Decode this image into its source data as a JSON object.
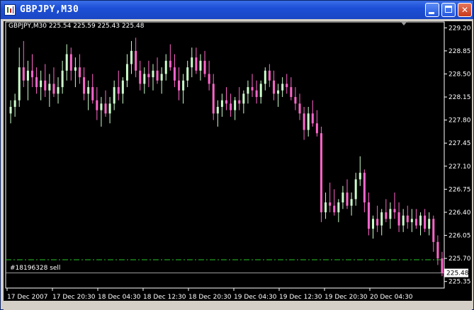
{
  "window": {
    "title": "GBPJPY,M30"
  },
  "chart": {
    "header": "GBPJPY,M30  225.54 225.59 225.43 225.48",
    "order_label": "#18196328 sell",
    "current_price": "225.48",
    "colors": {
      "bull": "#ccffcc",
      "bear": "#ff66cc",
      "order_line": "#26c326",
      "price_line": "#a0a0a0",
      "axis": "#ffffff"
    }
  },
  "chart_data": {
    "type": "candlestick",
    "symbol": "GBPJPY",
    "timeframe": "M30",
    "ylim": [
      225.25,
      229.3
    ],
    "y_ticks": [
      "229.20",
      "228.85",
      "228.50",
      "228.15",
      "227.80",
      "227.45",
      "227.10",
      "226.75",
      "226.40",
      "226.05",
      "225.70",
      "225.35"
    ],
    "x_ticks": [
      "17 Dec 2007",
      "17 Dec 20:30",
      "18 Dec 04:30",
      "18 Dec 12:30",
      "18 Dec 20:30",
      "19 Dec 04:30",
      "19 Dec 12:30",
      "19 Dec 20:30",
      "20 Dec 04:30"
    ],
    "order_level": 225.68,
    "bid": 225.48,
    "ohlc": [
      [
        227.9,
        228.1,
        227.75,
        228.0
      ],
      [
        228.0,
        228.2,
        227.85,
        228.1
      ],
      [
        228.1,
        228.9,
        228.0,
        228.6
      ],
      [
        228.6,
        229.0,
        228.3,
        228.4
      ],
      [
        228.4,
        228.7,
        228.1,
        228.55
      ],
      [
        228.55,
        228.8,
        228.3,
        228.45
      ],
      [
        228.45,
        228.6,
        228.2,
        228.3
      ],
      [
        228.3,
        228.55,
        228.1,
        228.4
      ],
      [
        228.4,
        228.65,
        228.15,
        228.25
      ],
      [
        228.25,
        228.5,
        228.0,
        228.35
      ],
      [
        228.35,
        228.6,
        228.15,
        228.2
      ],
      [
        228.2,
        228.45,
        228.05,
        228.3
      ],
      [
        228.3,
        228.7,
        228.2,
        228.55
      ],
      [
        228.55,
        228.95,
        228.4,
        228.8
      ],
      [
        228.8,
        228.9,
        228.4,
        228.55
      ],
      [
        228.55,
        228.75,
        228.3,
        228.6
      ],
      [
        228.6,
        228.8,
        228.35,
        228.45
      ],
      [
        228.45,
        228.6,
        228.1,
        228.2
      ],
      [
        228.2,
        228.4,
        227.95,
        228.3
      ],
      [
        228.3,
        228.5,
        228.05,
        228.1
      ],
      [
        228.1,
        228.3,
        227.8,
        227.95
      ],
      [
        227.95,
        228.15,
        227.7,
        228.05
      ],
      [
        228.05,
        228.25,
        227.85,
        227.9
      ],
      [
        227.9,
        228.15,
        227.75,
        228.05
      ],
      [
        228.05,
        228.4,
        227.95,
        228.3
      ],
      [
        228.3,
        228.55,
        228.1,
        228.2
      ],
      [
        228.2,
        228.45,
        228.05,
        228.4
      ],
      [
        228.4,
        228.8,
        228.3,
        228.65
      ],
      [
        228.65,
        229.0,
        228.5,
        228.85
      ],
      [
        228.85,
        229.05,
        228.45,
        228.55
      ],
      [
        228.55,
        228.7,
        228.25,
        228.35
      ],
      [
        228.35,
        228.6,
        228.2,
        228.5
      ],
      [
        228.5,
        228.7,
        228.3,
        228.45
      ],
      [
        228.45,
        228.65,
        228.25,
        228.55
      ],
      [
        228.55,
        228.75,
        228.35,
        228.4
      ],
      [
        228.4,
        228.6,
        228.2,
        228.5
      ],
      [
        228.5,
        228.8,
        228.4,
        228.7
      ],
      [
        228.7,
        228.95,
        228.55,
        228.6
      ],
      [
        228.6,
        228.8,
        228.3,
        228.4
      ],
      [
        228.4,
        228.6,
        228.1,
        228.25
      ],
      [
        228.25,
        228.5,
        228.05,
        228.4
      ],
      [
        228.4,
        228.7,
        228.3,
        228.6
      ],
      [
        228.6,
        228.9,
        228.45,
        228.75
      ],
      [
        228.75,
        228.9,
        228.5,
        228.55
      ],
      [
        228.55,
        228.8,
        228.4,
        228.7
      ],
      [
        228.7,
        228.85,
        228.45,
        228.5
      ],
      [
        228.5,
        228.7,
        228.25,
        228.35
      ],
      [
        228.35,
        228.5,
        227.8,
        227.9
      ],
      [
        227.9,
        228.1,
        227.7,
        228.0
      ],
      [
        228.0,
        228.2,
        227.85,
        228.1
      ],
      [
        228.1,
        228.3,
        227.95,
        228.05
      ],
      [
        228.05,
        228.2,
        227.85,
        227.95
      ],
      [
        227.95,
        228.15,
        227.8,
        228.1
      ],
      [
        228.1,
        228.3,
        227.95,
        228.05
      ],
      [
        228.05,
        228.25,
        227.9,
        228.2
      ],
      [
        228.2,
        228.4,
        228.05,
        228.3
      ],
      [
        228.3,
        228.5,
        228.15,
        228.25
      ],
      [
        228.25,
        228.4,
        228.05,
        228.15
      ],
      [
        228.15,
        228.4,
        228.05,
        228.35
      ],
      [
        228.35,
        228.6,
        228.25,
        228.55
      ],
      [
        228.55,
        228.65,
        228.3,
        228.4
      ],
      [
        228.4,
        228.55,
        228.1,
        228.2
      ],
      [
        228.2,
        228.35,
        228.0,
        228.25
      ],
      [
        228.25,
        228.45,
        228.15,
        228.35
      ],
      [
        228.35,
        228.5,
        228.2,
        228.3
      ],
      [
        228.3,
        228.45,
        228.1,
        228.15
      ],
      [
        228.15,
        228.3,
        227.95,
        228.05
      ],
      [
        228.05,
        228.2,
        227.8,
        227.9
      ],
      [
        227.9,
        228.0,
        227.5,
        227.65
      ],
      [
        227.65,
        228.0,
        227.55,
        227.9
      ],
      [
        227.9,
        228.1,
        227.7,
        227.75
      ],
      [
        227.75,
        227.95,
        227.55,
        227.6
      ],
      [
        227.6,
        227.7,
        226.25,
        226.4
      ],
      [
        226.4,
        226.7,
        226.3,
        226.55
      ],
      [
        226.55,
        226.85,
        226.4,
        226.5
      ],
      [
        226.5,
        226.75,
        226.35,
        226.4
      ],
      [
        226.4,
        226.6,
        226.25,
        226.55
      ],
      [
        226.55,
        226.8,
        226.45,
        226.7
      ],
      [
        226.7,
        226.9,
        226.45,
        226.5
      ],
      [
        226.5,
        226.7,
        226.35,
        226.6
      ],
      [
        226.6,
        227.0,
        226.5,
        226.9
      ],
      [
        226.9,
        227.25,
        226.8,
        227.0
      ],
      [
        227.0,
        227.05,
        226.4,
        226.55
      ],
      [
        226.55,
        226.7,
        226.05,
        226.15
      ],
      [
        226.15,
        226.35,
        226.0,
        226.3
      ],
      [
        226.3,
        226.5,
        226.1,
        226.2
      ],
      [
        226.2,
        226.45,
        226.05,
        226.4
      ],
      [
        226.4,
        226.6,
        226.25,
        226.3
      ],
      [
        226.3,
        226.55,
        226.15,
        226.45
      ],
      [
        226.45,
        226.7,
        226.3,
        226.4
      ],
      [
        226.4,
        226.55,
        226.1,
        226.2
      ],
      [
        226.2,
        226.45,
        226.1,
        226.35
      ],
      [
        226.35,
        226.5,
        226.15,
        226.25
      ],
      [
        226.25,
        226.45,
        226.1,
        226.3
      ],
      [
        226.3,
        226.45,
        226.15,
        226.2
      ],
      [
        226.2,
        226.4,
        226.05,
        226.35
      ],
      [
        226.35,
        226.45,
        226.1,
        226.15
      ],
      [
        226.15,
        226.4,
        226.05,
        226.3
      ],
      [
        226.3,
        226.35,
        225.8,
        225.95
      ],
      [
        225.95,
        226.05,
        225.6,
        225.7
      ],
      [
        225.7,
        225.8,
        225.43,
        225.48
      ]
    ]
  }
}
